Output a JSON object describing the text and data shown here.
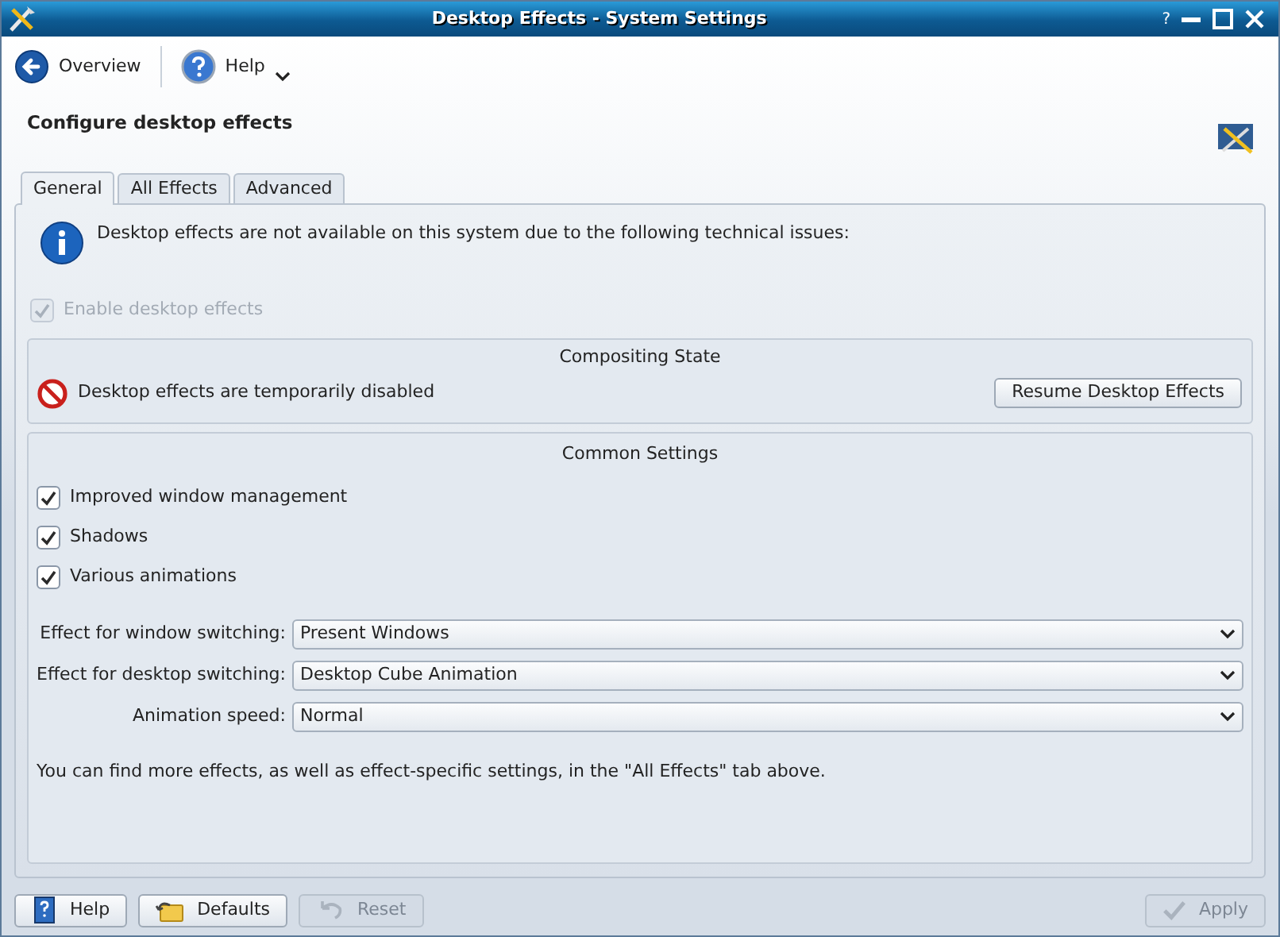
{
  "window": {
    "title": "Desktop Effects - System Settings",
    "help_glyph": "?"
  },
  "toolbar": [
    {
      "label": "Overview",
      "kind": "back",
      "menu": false
    },
    {
      "label": "Help",
      "kind": "help",
      "menu": true
    }
  ],
  "heading": "Configure desktop effects",
  "tabs": [
    {
      "label": "General",
      "selected": true
    },
    {
      "label": "All Effects",
      "selected": false
    },
    {
      "label": "Advanced",
      "selected": false
    }
  ],
  "notice": "Desktop effects are not available on this system due to the following technical issues:",
  "enable": {
    "label": "Enable desktop effects",
    "checked": true,
    "disabled": true
  },
  "compositing": {
    "title": "Compositing State",
    "status": "Desktop effects are temporarily disabled",
    "button": "Resume Desktop Effects"
  },
  "common": {
    "title": "Common Settings",
    "options": [
      {
        "label": "Improved window management",
        "checked": true
      },
      {
        "label": "Shadows",
        "checked": true
      },
      {
        "label": "Various animations",
        "checked": true
      }
    ],
    "selects": [
      {
        "label": "Effect for window switching:",
        "value": "Present Windows"
      },
      {
        "label": "Effect for desktop switching:",
        "value": "Desktop Cube Animation"
      },
      {
        "label": "Animation speed:",
        "value": "Normal"
      }
    ],
    "note": "You can find more effects, as well as effect-specific settings, in the \"All Effects\" tab above."
  },
  "footer": [
    {
      "label": "Help",
      "kind": "help",
      "disabled": false
    },
    {
      "label": "Defaults",
      "kind": "defaults",
      "disabled": false
    },
    {
      "label": "Reset",
      "kind": "reset",
      "disabled": true
    },
    {
      "label": "Apply",
      "kind": "apply",
      "disabled": true
    }
  ]
}
